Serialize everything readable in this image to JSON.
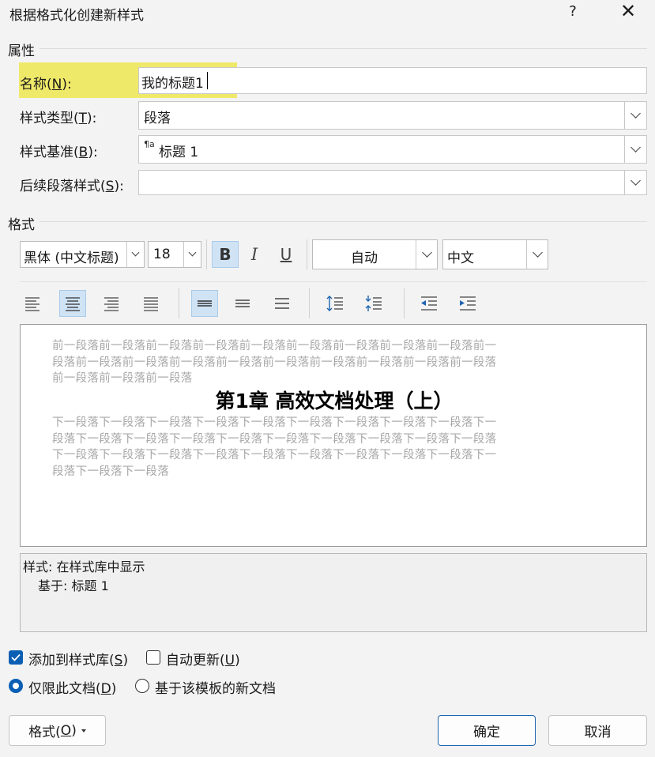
{
  "window": {
    "title": "根据格式化创建新样式",
    "help": "?",
    "close": "✕"
  },
  "properties": {
    "section_title": "属性",
    "name_label": "名称(",
    "name_key": "N",
    "name_suffix": "):",
    "name_value": "我的标题1",
    "type_label": "样式类型(",
    "type_key": "T",
    "type_suffix": "):",
    "type_value": "段落",
    "based_label": "样式基准(",
    "based_key": "B",
    "based_suffix": "):",
    "based_icon": "¶a",
    "based_value": "标题 1",
    "follow_label": "后续段落样式(",
    "follow_key": "S",
    "follow_suffix": "):",
    "follow_value": ""
  },
  "format": {
    "section_title": "格式",
    "font": "黑体 (中文标题)",
    "size": "18",
    "bold": "B",
    "italic": "I",
    "underline": "U",
    "color": "自动",
    "language": "中文"
  },
  "preview": {
    "before_lines": [
      "前一段落前一段落前一段落前一段落前一段落前一段落前一段落前一段落前一段落前一",
      "段落前一段落前一段落前一段落前一段落前一段落前一段落前一段落前一段落前一段落",
      "前一段落前一段落前一段落"
    ],
    "heading": "第1章  高效文档处理（上）",
    "after_lines": [
      "下一段落下一段落下一段落下一段落下一段落下一段落下一段落下一段落下一段落下一",
      "段落下一段落下一段落下一段落下一段落下一段落下一段落下一段落下一段落下一段落",
      "下一段落下一段落下一段落下一段落下一段落下一段落下一段落下一段落下一段落下一",
      "段落下一段落下一段落"
    ]
  },
  "description": {
    "line1": "样式: 在样式库中显示",
    "line2": "基于: 标题 1"
  },
  "options": {
    "add_gallery_label": "添加到样式库(",
    "add_gallery_key": "S",
    "add_gallery_suffix": ")",
    "add_gallery_checked": true,
    "auto_update_label": "自动更新(",
    "auto_update_key": "U",
    "auto_update_suffix": ")",
    "auto_update_checked": false,
    "only_doc_label": "仅限此文档(",
    "only_doc_key": "D",
    "only_doc_suffix": ")",
    "only_doc_selected": true,
    "template_label": "基于该模板的新文档",
    "template_selected": false
  },
  "buttons": {
    "format_label": "格式(",
    "format_key": "O",
    "format_suffix": ")",
    "ok": "确定",
    "cancel": "取消"
  },
  "colors": {
    "highlight": "#efe96a",
    "accent": "#0a5fb4",
    "active_button": "#cfe3f5"
  }
}
